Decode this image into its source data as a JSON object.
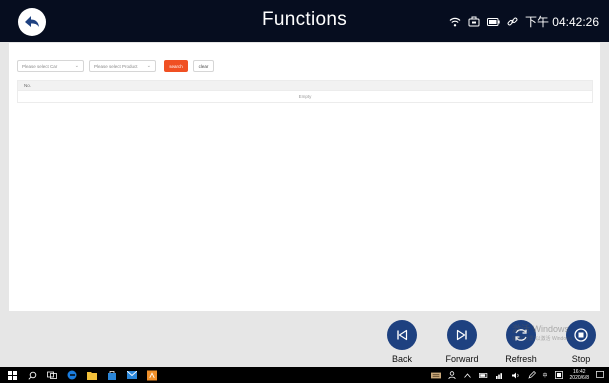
{
  "header": {
    "title": "Functions",
    "time": "下午 04:42:26",
    "icons": [
      "back-arrow-icon",
      "wifi-icon",
      "device-icon",
      "battery-icon",
      "link-icon"
    ]
  },
  "filters": {
    "car_placeholder": "Please select Car",
    "product_placeholder": "Please select Product",
    "search_label": "search",
    "clear_label": "clear"
  },
  "table": {
    "header_no": "No.",
    "empty_text": "Empty"
  },
  "toolbar": {
    "back_label": "Back",
    "forward_label": "Forward",
    "refresh_label": "Refresh",
    "stop_label": "Stop"
  },
  "watermark": {
    "line1": "激活 Windows",
    "line2": "转到\"设置\"以激活 Windows。"
  },
  "taskbar": {
    "clock_time": "16:42",
    "clock_date": "2020/6/8",
    "ime": "中"
  },
  "colors": {
    "header_bg": "#060d1f",
    "accent_orange": "#f05023",
    "toolbar_button": "#1e4180"
  }
}
